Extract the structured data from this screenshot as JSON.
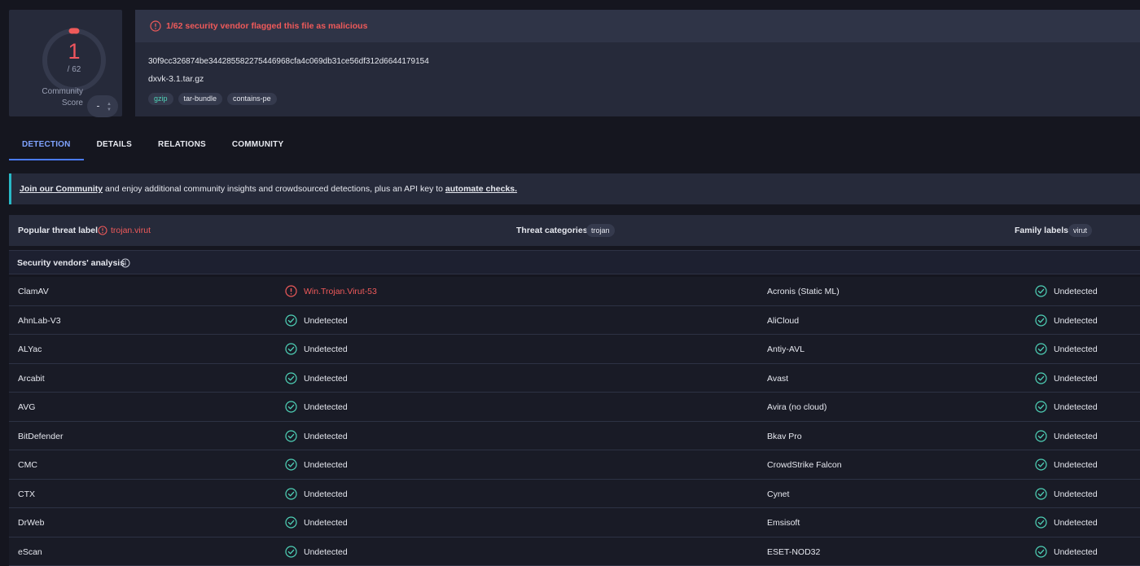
{
  "score": {
    "detections": "1",
    "total": "/ 62",
    "community_label_line1": "Community",
    "community_label_line2": "Score",
    "community_value": "-"
  },
  "alert": {
    "text": "1/62 security vendor flagged this file as malicious"
  },
  "file": {
    "hash": "30f9cc326874be344285582275446968cfa4c069db31ce56df312d6644179154",
    "name": "dxvk-3.1.tar.gz",
    "tags": [
      "gzip",
      "tar-bundle",
      "contains-pe"
    ]
  },
  "tabs": [
    "DETECTION",
    "DETAILS",
    "RELATIONS",
    "COMMUNITY"
  ],
  "banner": {
    "link1": "Join our Community",
    "middle": " and enjoy additional community insights and crowdsourced detections, plus an API key to ",
    "link2": "automate checks."
  },
  "threat": {
    "popular_label": "Popular threat label",
    "popular_value": "trojan.virut",
    "categories_label": "Threat categories",
    "categories_value": "trojan",
    "family_label": "Family labels",
    "family_value": "virut"
  },
  "vendors_heading": "Security vendors' analysis",
  "vendors": [
    {
      "left": "ClamAV",
      "left_result": "Win.Trojan.Virut-53",
      "left_malicious": true,
      "right": "Acronis (Static ML)",
      "right_result": "Undetected"
    },
    {
      "left": "AhnLab-V3",
      "left_result": "Undetected",
      "right": "AliCloud",
      "right_result": "Undetected"
    },
    {
      "left": "ALYac",
      "left_result": "Undetected",
      "right": "Antiy-AVL",
      "right_result": "Undetected"
    },
    {
      "left": "Arcabit",
      "left_result": "Undetected",
      "right": "Avast",
      "right_result": "Undetected"
    },
    {
      "left": "AVG",
      "left_result": "Undetected",
      "right": "Avira (no cloud)",
      "right_result": "Undetected"
    },
    {
      "left": "BitDefender",
      "left_result": "Undetected",
      "right": "Bkav Pro",
      "right_result": "Undetected"
    },
    {
      "left": "CMC",
      "left_result": "Undetected",
      "right": "CrowdStrike Falcon",
      "right_result": "Undetected"
    },
    {
      "left": "CTX",
      "left_result": "Undetected",
      "right": "Cynet",
      "right_result": "Undetected"
    },
    {
      "left": "DrWeb",
      "left_result": "Undetected",
      "right": "Emsisoft",
      "right_result": "Undetected"
    },
    {
      "left": "eScan",
      "left_result": "Undetected",
      "right": "ESET-NOD32",
      "right_result": "Undetected"
    }
  ],
  "colors": {
    "malicious": "#ef5a5a",
    "clean": "#4fd3b8",
    "accent": "#4b7bff",
    "banner_accent": "#29b9c7"
  },
  "icons": {
    "alert": "exclamation-circle-icon",
    "clean": "check-circle-icon",
    "info": "info-circle-icon"
  }
}
